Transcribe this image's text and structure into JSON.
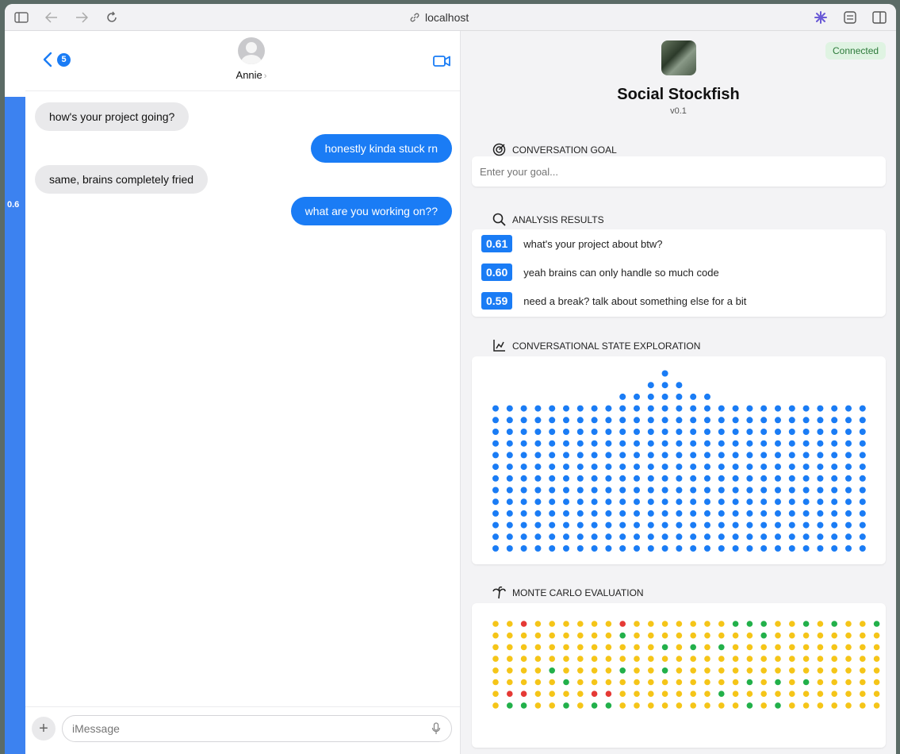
{
  "browser": {
    "url": "localhost"
  },
  "score_strip": {
    "label": "0.6",
    "value": 0.6
  },
  "chat": {
    "back_badge": "5",
    "contact_name": "Annie",
    "messages": [
      {
        "from": "them",
        "text": "how's your project going?"
      },
      {
        "from": "me",
        "text": "honestly kinda stuck rn"
      },
      {
        "from": "them",
        "text": "same, brains completely fried"
      },
      {
        "from": "me",
        "text": "what are you working on??"
      }
    ],
    "composer_placeholder": "iMessage"
  },
  "panel": {
    "status": "Connected",
    "title": "Social Stockfish",
    "version": "v0.1",
    "goal_heading": "CONVERSATION GOAL",
    "goal_placeholder": "Enter your goal...",
    "results_heading": "ANALYSIS RESULTS",
    "results": [
      {
        "score": "0.61",
        "text": "what's your project about btw?"
      },
      {
        "score": "0.60",
        "text": "yeah brains can only handle so much code"
      },
      {
        "score": "0.59",
        "text": "need a break? talk about something else for a bit"
      }
    ],
    "exploration_heading": "CONVERSATIONAL STATE EXPLORATION",
    "exploration_columns": [
      13,
      13,
      13,
      13,
      13,
      13,
      13,
      13,
      13,
      14,
      14,
      15,
      16,
      15,
      14,
      14,
      13,
      13,
      13,
      13,
      13,
      13,
      13,
      13,
      13,
      13,
      13
    ],
    "exploration_color": "#1a7cf5",
    "monte_carlo_heading": "MONTE CARLO EVALUATION",
    "monte_carlo_colors": {
      "Y": "#f5c518",
      "G": "#22b04a",
      "R": "#e53935"
    },
    "monte_carlo_grid": [
      "YYRYYYYYYRYYYYYYYGGGYYGYGYYG",
      "YYYYYYYYYGYYYYYYYYYGYYYYYYYY",
      "YYYYYYYYYYYYGYGYGYYYYYYYYYYY",
      "YYYYYYYYYYYYYYYYYYYYYYYYYYYY",
      "YYYYGYYYYGYYGYYYYYYYYYYYYYYY",
      "YYYYYGYYYYYYYYYYYYGYGYGYYYYY",
      "YRRYYYYRRYYYYYYYGYYYYYYYYYYY",
      "YGGYYGYGGYYYYYYYYYGYGYYYYYYY"
    ]
  }
}
